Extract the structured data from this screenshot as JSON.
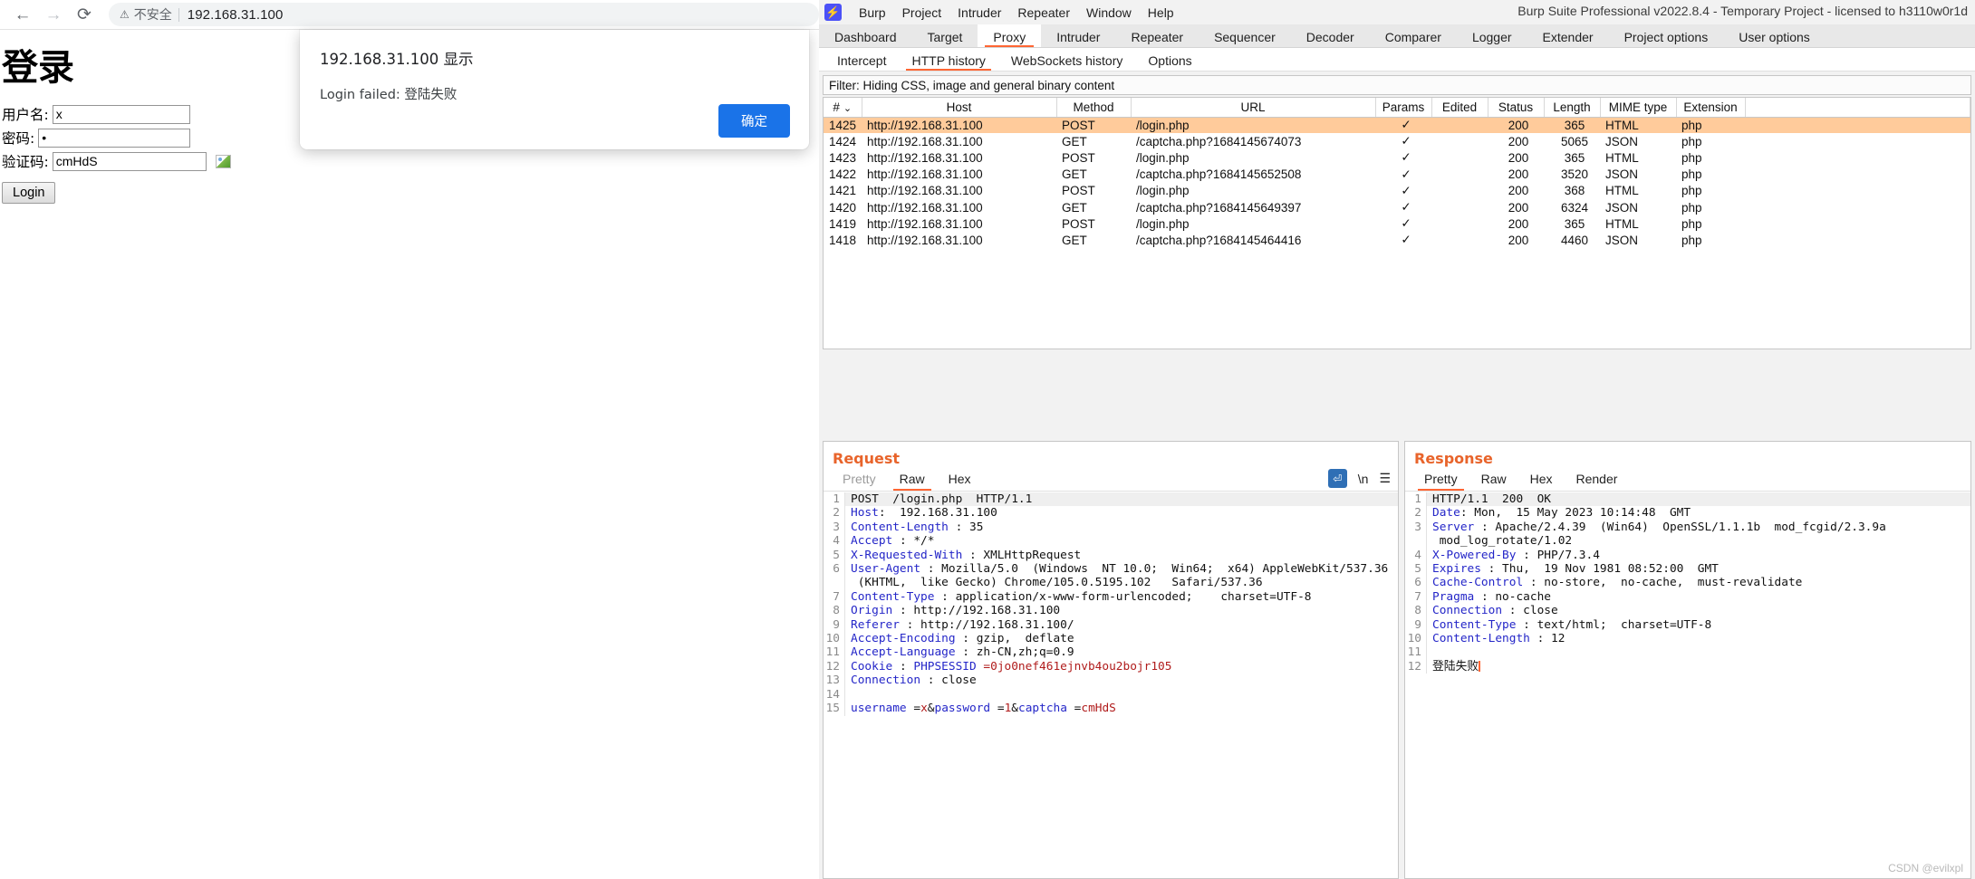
{
  "browser": {
    "nav": {
      "back": "←",
      "forward": "→",
      "reload": "⟳"
    },
    "omnibox": {
      "warning_icon": "⚠",
      "insecure_label": "不安全",
      "url": "192.168.31.100"
    },
    "page": {
      "title": "登录",
      "fields": [
        {
          "label": "用户名:",
          "value": "x",
          "name": "username"
        },
        {
          "label": "密码:",
          "value": "•",
          "name": "password"
        },
        {
          "label": "验证码:",
          "value": "cmHdS",
          "name": "captcha"
        }
      ],
      "submit_label": "Login"
    },
    "dialog": {
      "title": "192.168.31.100 显示",
      "message": "Login failed: 登陆失败",
      "ok_label": "确定"
    }
  },
  "burp": {
    "logo_glyph": "⚡",
    "menu": [
      "Burp",
      "Project",
      "Intruder",
      "Repeater",
      "Window",
      "Help"
    ],
    "title": "Burp Suite Professional v2022.8.4 - Temporary Project - licensed to h3110w0r1d",
    "main_tabs": [
      "Dashboard",
      "Target",
      "Proxy",
      "Intruder",
      "Repeater",
      "Sequencer",
      "Decoder",
      "Comparer",
      "Logger",
      "Extender",
      "Project options",
      "User options"
    ],
    "main_tab_active": "Proxy",
    "sub_tabs": [
      "Intercept",
      "HTTP history",
      "WebSockets history",
      "Options"
    ],
    "sub_tab_active": "HTTP history",
    "filter_text": "Filter: Hiding CSS, image and general binary content",
    "table": {
      "columns": [
        "#",
        "Host",
        "Method",
        "URL",
        "Params",
        "Edited",
        "Status",
        "Length",
        "MIME type",
        "Extension"
      ],
      "sort_indicator": "⌄",
      "check_glyph": "✓",
      "selected_row": 0,
      "rows": [
        {
          "num": "1425",
          "host": "http://192.168.31.100",
          "method": "POST",
          "url": "/login.php",
          "params": "✓",
          "edited": "",
          "status": "200",
          "length": "365",
          "mime": "HTML",
          "ext": "php"
        },
        {
          "num": "1424",
          "host": "http://192.168.31.100",
          "method": "GET",
          "url": "/captcha.php?1684145674073",
          "params": "✓",
          "edited": "",
          "status": "200",
          "length": "5065",
          "mime": "JSON",
          "ext": "php"
        },
        {
          "num": "1423",
          "host": "http://192.168.31.100",
          "method": "POST",
          "url": "/login.php",
          "params": "✓",
          "edited": "",
          "status": "200",
          "length": "365",
          "mime": "HTML",
          "ext": "php"
        },
        {
          "num": "1422",
          "host": "http://192.168.31.100",
          "method": "GET",
          "url": "/captcha.php?1684145652508",
          "params": "✓",
          "edited": "",
          "status": "200",
          "length": "3520",
          "mime": "JSON",
          "ext": "php"
        },
        {
          "num": "1421",
          "host": "http://192.168.31.100",
          "method": "POST",
          "url": "/login.php",
          "params": "✓",
          "edited": "",
          "status": "200",
          "length": "368",
          "mime": "HTML",
          "ext": "php"
        },
        {
          "num": "1420",
          "host": "http://192.168.31.100",
          "method": "GET",
          "url": "/captcha.php?1684145649397",
          "params": "✓",
          "edited": "",
          "status": "200",
          "length": "6324",
          "mime": "JSON",
          "ext": "php"
        },
        {
          "num": "1419",
          "host": "http://192.168.31.100",
          "method": "POST",
          "url": "/login.php",
          "params": "✓",
          "edited": "",
          "status": "200",
          "length": "365",
          "mime": "HTML",
          "ext": "php"
        },
        {
          "num": "1418",
          "host": "http://192.168.31.100",
          "method": "GET",
          "url": "/captcha.php?1684145464416",
          "params": "✓",
          "edited": "",
          "status": "200",
          "length": "4460",
          "mime": "JSON",
          "ext": "php"
        }
      ]
    },
    "request": {
      "heading": "Request",
      "tabs": [
        "Pretty",
        "Raw",
        "Hex"
      ],
      "tab_active": "Raw",
      "tools": {
        "wrap_icon": "⏎",
        "newline_label": "\\n",
        "menu_icon": "☰"
      },
      "lines": [
        {
          "n": "1",
          "parts": [
            {
              "t": "POST  /login.php  HTTP/1.1",
              "c": "v"
            }
          ]
        },
        {
          "n": "2",
          "parts": [
            {
              "t": "Host",
              "c": "k"
            },
            {
              "t": ":  192.168.31.100",
              "c": "v"
            }
          ]
        },
        {
          "n": "3",
          "parts": [
            {
              "t": "Content-Length",
              "c": "k"
            },
            {
              "t": " : 35",
              "c": "v"
            }
          ]
        },
        {
          "n": "4",
          "parts": [
            {
              "t": "Accept",
              "c": "k"
            },
            {
              "t": " : */*",
              "c": "v"
            }
          ]
        },
        {
          "n": "5",
          "parts": [
            {
              "t": "X-Requested-With",
              "c": "k"
            },
            {
              "t": " : XMLHttpRequest",
              "c": "v"
            }
          ]
        },
        {
          "n": "6",
          "parts": [
            {
              "t": "User-Agent",
              "c": "k"
            },
            {
              "t": " : Mozilla/5.0  (Windows  NT 10.0;  Win64;  x64) AppleWebKit/537.36\n (KHTML,  like Gecko) Chrome/105.0.5195.102   Safari/537.36",
              "c": "v"
            }
          ]
        },
        {
          "n": "7",
          "parts": [
            {
              "t": "Content-Type",
              "c": "k"
            },
            {
              "t": " : application/x-www-form-urlencoded;    charset=UTF-8",
              "c": "v"
            }
          ]
        },
        {
          "n": "8",
          "parts": [
            {
              "t": "Origin",
              "c": "k"
            },
            {
              "t": " : http://192.168.31.100",
              "c": "v"
            }
          ]
        },
        {
          "n": "9",
          "parts": [
            {
              "t": "Referer",
              "c": "k"
            },
            {
              "t": " : http://192.168.31.100/",
              "c": "v"
            }
          ]
        },
        {
          "n": "10",
          "parts": [
            {
              "t": "Accept-Encoding",
              "c": "k"
            },
            {
              "t": " : gzip,  deflate",
              "c": "v"
            }
          ]
        },
        {
          "n": "11",
          "parts": [
            {
              "t": "Accept-Language",
              "c": "k"
            },
            {
              "t": " : zh-CN,zh;q=0.9",
              "c": "v"
            }
          ]
        },
        {
          "n": "12",
          "parts": [
            {
              "t": "Cookie",
              "c": "k"
            },
            {
              "t": " : ",
              "c": "v"
            },
            {
              "t": "PHPSESSID",
              "c": "k"
            },
            {
              "t": " =0jo0nef461ejnvb4ou2bojr105",
              "c": "r"
            }
          ]
        },
        {
          "n": "13",
          "parts": [
            {
              "t": "Connection",
              "c": "k"
            },
            {
              "t": " : close",
              "c": "v"
            }
          ]
        },
        {
          "n": "14",
          "parts": [
            {
              "t": "",
              "c": "v"
            }
          ]
        },
        {
          "n": "15",
          "parts": [
            {
              "t": "username",
              "c": "k"
            },
            {
              "t": " =",
              "c": "v"
            },
            {
              "t": "x",
              "c": "r"
            },
            {
              "t": "&",
              "c": "v"
            },
            {
              "t": "password",
              "c": "k"
            },
            {
              "t": " =",
              "c": "v"
            },
            {
              "t": "1",
              "c": "r"
            },
            {
              "t": "&",
              "c": "v"
            },
            {
              "t": "captcha",
              "c": "k"
            },
            {
              "t": " =",
              "c": "v"
            },
            {
              "t": "cmHdS",
              "c": "r"
            }
          ]
        }
      ]
    },
    "response": {
      "heading": "Response",
      "tabs": [
        "Pretty",
        "Raw",
        "Hex",
        "Render"
      ],
      "tab_active": "Pretty",
      "lines": [
        {
          "n": "1",
          "parts": [
            {
              "t": "HTTP/1.1  200  OK",
              "c": "v"
            }
          ]
        },
        {
          "n": "2",
          "parts": [
            {
              "t": "Date",
              "c": "k"
            },
            {
              "t": ": Mon,  15 May 2023 10:14:48  GMT",
              "c": "v"
            }
          ]
        },
        {
          "n": "3",
          "parts": [
            {
              "t": "Server",
              "c": "k"
            },
            {
              "t": " : Apache/2.4.39  (Win64)  OpenSSL/1.1.1b  mod_fcgid/2.3.9a\n mod_log_rotate/1.02",
              "c": "v"
            }
          ]
        },
        {
          "n": "4",
          "parts": [
            {
              "t": "X-Powered-By",
              "c": "k"
            },
            {
              "t": " : PHP/7.3.4",
              "c": "v"
            }
          ]
        },
        {
          "n": "5",
          "parts": [
            {
              "t": "Expires",
              "c": "k"
            },
            {
              "t": " : Thu,  19 Nov 1981 08:52:00  GMT",
              "c": "v"
            }
          ]
        },
        {
          "n": "6",
          "parts": [
            {
              "t": "Cache-Control",
              "c": "k"
            },
            {
              "t": " : no-store,  no-cache,  must-revalidate",
              "c": "v"
            }
          ]
        },
        {
          "n": "7",
          "parts": [
            {
              "t": "Pragma",
              "c": "k"
            },
            {
              "t": " : no-cache",
              "c": "v"
            }
          ]
        },
        {
          "n": "8",
          "parts": [
            {
              "t": "Connection",
              "c": "k"
            },
            {
              "t": " : close",
              "c": "v"
            }
          ]
        },
        {
          "n": "9",
          "parts": [
            {
              "t": "Content-Type",
              "c": "k"
            },
            {
              "t": " : text/html;  charset=UTF-8",
              "c": "v"
            }
          ]
        },
        {
          "n": "10",
          "parts": [
            {
              "t": "Content-Length",
              "c": "k"
            },
            {
              "t": " : 12",
              "c": "v"
            }
          ]
        },
        {
          "n": "11",
          "parts": [
            {
              "t": "",
              "c": "v"
            }
          ]
        },
        {
          "n": "12",
          "parts": [
            {
              "t": "登陆失败",
              "c": "v"
            }
          ],
          "caret": true
        }
      ]
    },
    "watermark": "CSDN @evilxpl"
  },
  "colors": {
    "accent_orange": "#ff6633",
    "selected_row": "#ffcb9b",
    "heading_orange": "#e8642b",
    "link_blue": "#1a73e8",
    "burp_logo": "#4b51f7"
  }
}
